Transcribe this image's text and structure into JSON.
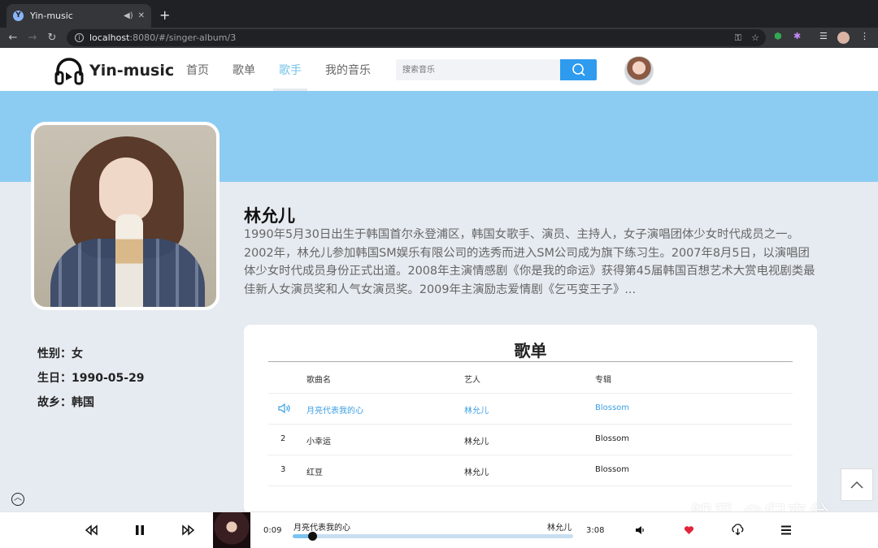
{
  "browser": {
    "tab_title": "Yin-music",
    "new_tab_symbol": "+",
    "url_host": "localhost",
    "url_rest": ":8080/#/singer-album/3"
  },
  "header": {
    "logo_text": "Yin-music",
    "nav": [
      "首页",
      "歌单",
      "歌手",
      "我的音乐"
    ],
    "active_nav": "歌手",
    "search_placeholder": "搜索音乐"
  },
  "singer": {
    "name": "林允儿",
    "intro": "1990年5月30日出生于韩国首尔永登浦区，韩国女歌手、演员、主持人，女子演唱团体少女时代成员之一。2002年，林允儿参加韩国SM娱乐有限公司的选秀而进入SM公司成为旗下练习生。2007年8月5日，以演唱团体少女时代成员身份正式出道。2008年主演情感剧《你是我的命运》获得第45届韩国百想艺术大赏电视剧类最佳新人女演员奖和人气女演员奖。2009年主演励志爱情剧《乞丐变王子》...",
    "attrs": {
      "gender": "性别：女",
      "birthday": "生日：1990-05-29",
      "hometown": "故乡：韩国"
    }
  },
  "songlist": {
    "title": "歌单",
    "columns": [
      "歌曲名",
      "艺人",
      "专辑"
    ],
    "rows": [
      {
        "index": "",
        "name": "月亮代表我的心",
        "artist": "林允儿",
        "album": "Blossom",
        "playing": true
      },
      {
        "index": "2",
        "name": "小幸运",
        "artist": "林允儿",
        "album": "Blossom",
        "playing": false
      },
      {
        "index": "3",
        "name": "红豆",
        "artist": "林允儿",
        "album": "Blossom",
        "playing": false
      }
    ]
  },
  "player": {
    "current_time": "0:09",
    "total_time": "3:08",
    "title": "月亮代表我的心",
    "artist": "林允儿",
    "progress": 0.07
  },
  "watermark": "知乎 @归来兮",
  "colors": {
    "accent": "#75c2ea",
    "banner": "#8cccf3",
    "search_button": "#2e9bef",
    "playing_text": "#3b9fe3",
    "like": "#e0243a"
  }
}
